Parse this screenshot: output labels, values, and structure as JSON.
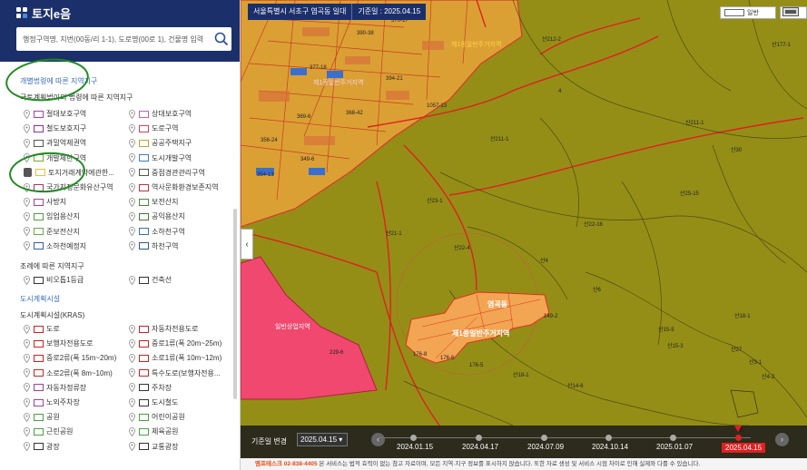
{
  "app": {
    "logo_text": "토지e음",
    "search_placeholder": "행정구역명, 지번(00동/리 1-1), 도로명(00로 1), 건물명 입력"
  },
  "sidebar": {
    "section1_title": "개별법령에 따른 지역지구",
    "section1_sub": "국토계획법이외 법령에 따른 지역지구",
    "section1_items": [
      {
        "label": "절대보호구역",
        "color": "#b53aa8"
      },
      {
        "label": "상대보호구역",
        "color": "#c060b0"
      },
      {
        "label": "철도보호지구",
        "color": "#8a2fa8"
      },
      {
        "label": "도로구역",
        "color": "#d0406a"
      },
      {
        "label": "과밀억제권역",
        "color": "#555555"
      },
      {
        "label": "공공주택지구",
        "color": "#c8a030"
      },
      {
        "label": "개발제한구역",
        "color": "#7aa830"
      },
      {
        "label": "도시개발구역",
        "color": "#3a80c0"
      },
      {
        "label": "토지거래계약에관한...",
        "color": "#e8c040"
      },
      {
        "label": "중점경관관리구역",
        "color": "#555555"
      },
      {
        "label": "국가지정문화유산구역",
        "color": "#b03060"
      },
      {
        "label": "역사문화환경보존지역",
        "color": "#c03040"
      },
      {
        "label": "사방지",
        "color": "#a840a0"
      },
      {
        "label": "보전산지",
        "color": "#4a8a3a"
      },
      {
        "label": "임업용산지",
        "color": "#5a9a40"
      },
      {
        "label": "공익용산지",
        "color": "#3a7a30"
      },
      {
        "label": "준보전산지",
        "color": "#6aa848"
      },
      {
        "label": "소하천구역",
        "color": "#3a70b0"
      },
      {
        "label": "소하천예정지",
        "color": "#3a60a0"
      },
      {
        "label": "하천구역",
        "color": "#2a5a90"
      }
    ],
    "section2_title": "조례에 따른 지역지구",
    "section2_items": [
      {
        "label": "비오톱1등급",
        "color": "#333333"
      },
      {
        "label": "건축선",
        "color": "#333333"
      }
    ],
    "section3_title": "도시계획시설",
    "section3_sub": "도시계획시설(KRAS)",
    "section3_items": [
      {
        "label": "도로",
        "color": "#d02020"
      },
      {
        "label": "자동차전용도로",
        "color": "#d02020"
      },
      {
        "label": "보행자전용도로",
        "color": "#d02020"
      },
      {
        "label": "중로1류(폭 20m~25m)",
        "color": "#d02020"
      },
      {
        "label": "중로2류(폭 15m~20m)",
        "color": "#d02020"
      },
      {
        "label": "소로1류(폭 10m~12m)",
        "color": "#d02020"
      },
      {
        "label": "소로2류(폭 8m~10m)",
        "color": "#d02020"
      },
      {
        "label": "특수도로(보행자전용...",
        "color": "#d02020"
      },
      {
        "label": "자동차정류장",
        "color": "#a040a0"
      },
      {
        "label": "주차장",
        "color": "#333333"
      },
      {
        "label": "노외주차장",
        "color": "#a040a0"
      },
      {
        "label": "도시철도",
        "color": "#333333"
      },
      {
        "label": "공원",
        "color": "#4aa040"
      },
      {
        "label": "어린이공원",
        "color": "#4aa040"
      },
      {
        "label": "근린공원",
        "color": "#4aa040"
      },
      {
        "label": "체육공원",
        "color": "#4aa040"
      },
      {
        "label": "광장",
        "color": "#333333"
      },
      {
        "label": "교통광장",
        "color": "#333333"
      }
    ]
  },
  "map": {
    "location_badge": "서울특별시 서초구 염곡동 일대",
    "base_date_badge": "기준일 : 2025.04.15",
    "legend_toggle_label": "일반",
    "labels": {
      "district_top": "제1종일반주거지역",
      "district_left": "제1종일반주거지역",
      "district_center": "제1종일반주거지역",
      "district_dong": "염곡동",
      "district_commercial": "일반상업지역"
    },
    "parcel_labels": [
      "370-14",
      "370-17",
      "390-38",
      "377-18",
      "394-21",
      "368-42",
      "1057-13",
      "산212-2",
      "산211-1",
      "산211-1",
      "4",
      "산25-15",
      "산23-1",
      "산21-1",
      "산22-16",
      "산22-4",
      "산30",
      "산4",
      "산6",
      "산27",
      "149-2",
      "176-6",
      "176-8",
      "176-5",
      "산18-1",
      "산14-6",
      "229-6",
      "산15-5",
      "산15-3",
      "산3-1",
      "산4-2",
      "산18-1",
      "354-13",
      "369-6",
      "349-6",
      "356-24",
      "산177-1"
    ]
  },
  "timeline": {
    "label": "기준일 변경",
    "selected": "2025.04.15",
    "dates": [
      "2024.01.15",
      "2024.04.17",
      "2024.07.09",
      "2024.10.14",
      "2025.01.07",
      "2025.04.15"
    ]
  },
  "footer": {
    "company": "엠프테스크",
    "phone": "02-838-4405",
    "notice": "본 서비스는 법적 효력이 없는 참고 자료이며, 모든 지역·지구 정보를 표시하지 않습니다. 또한 자료 생성 및 서비스 시점 차이로 인해 실제와 다를 수 있습니다."
  }
}
